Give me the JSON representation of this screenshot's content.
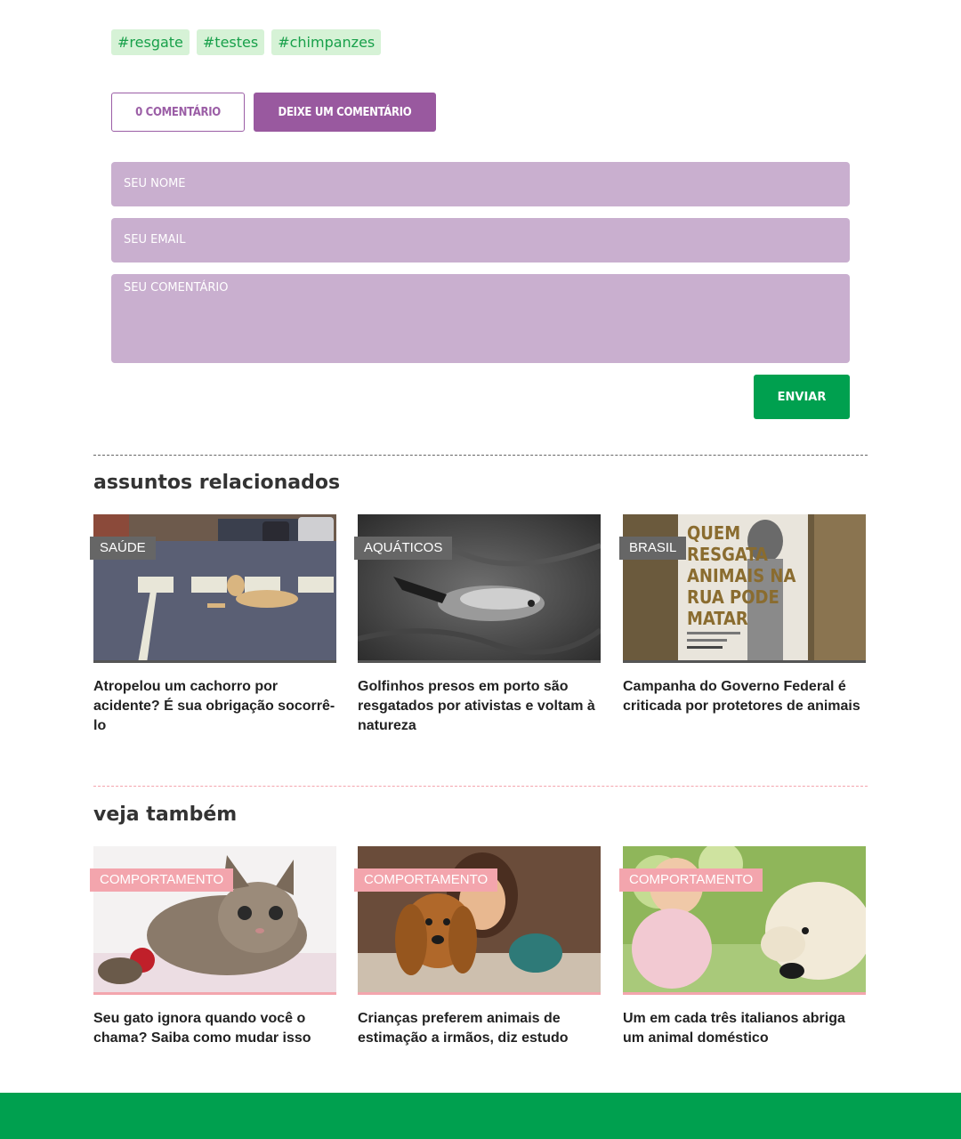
{
  "tags": [
    "#resgate",
    "#testes",
    "#chimpanzes"
  ],
  "comments": {
    "count_label": "0 COMENTÁRIO",
    "leave_label": "DEIXE UM COMENTÁRIO"
  },
  "form": {
    "name_placeholder": "SEU NOME",
    "email_placeholder": "SEU EMAIL",
    "comment_placeholder": "SEU COMENTÁRIO",
    "submit_label": "ENVIAR"
  },
  "related": {
    "title": "assuntos relacionados",
    "cards": [
      {
        "category": "SAÚDE",
        "title": "Atropelou um cachorro por acidente? É sua obrigação socorrê-lo"
      },
      {
        "category": "AQUÁTICOS",
        "title": "Golfinhos presos em porto são resgatados por ativistas e voltam à natureza"
      },
      {
        "category": "BRASIL",
        "title": "Campanha do Governo Federal é criticada por protetores de animais",
        "poster_text": "QUEM RESGATA ANIMAIS NA RUA PODE MATAR"
      }
    ]
  },
  "see_also": {
    "title": "veja também",
    "cards": [
      {
        "category": "COMPORTAMENTO",
        "title": "Seu gato ignora quando você o chama? Saiba como mudar isso"
      },
      {
        "category": "COMPORTAMENTO",
        "title": "Crianças preferem animais de estimação a irmãos, diz estudo"
      },
      {
        "category": "COMPORTAMENTO",
        "title": "Um em cada três italianos abriga um animal doméstico"
      }
    ]
  },
  "colors": {
    "purple": "#99599f",
    "field": "#c9afcf",
    "green": "#00a04f",
    "tag_bg": "#d6f2d6",
    "pink": "#f3a5ad"
  }
}
